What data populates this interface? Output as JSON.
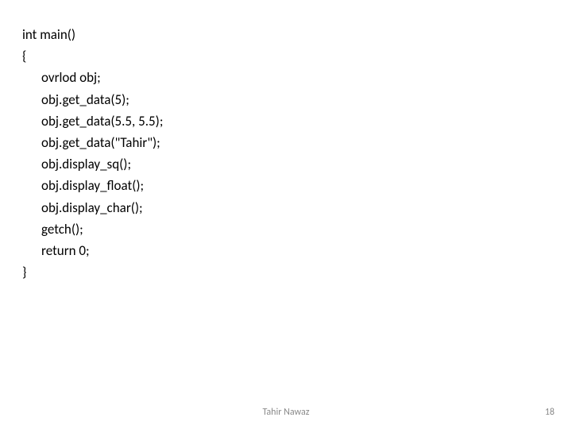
{
  "code": {
    "l0": "int main()",
    "l1": "{",
    "l2": "ovrlod obj;",
    "l3": "obj.get_data(5);",
    "l4": "obj.get_data(5.5, 5.5);",
    "l5": "obj.get_data(\"Tahir\");",
    "l6": "obj.display_sq();",
    "l7": "obj.display_float();",
    "l8": "obj.display_char();",
    "l9": "getch();",
    "l10": "return 0;",
    "l11": "}"
  },
  "footer": {
    "author": "Tahir Nawaz",
    "page": "18"
  }
}
